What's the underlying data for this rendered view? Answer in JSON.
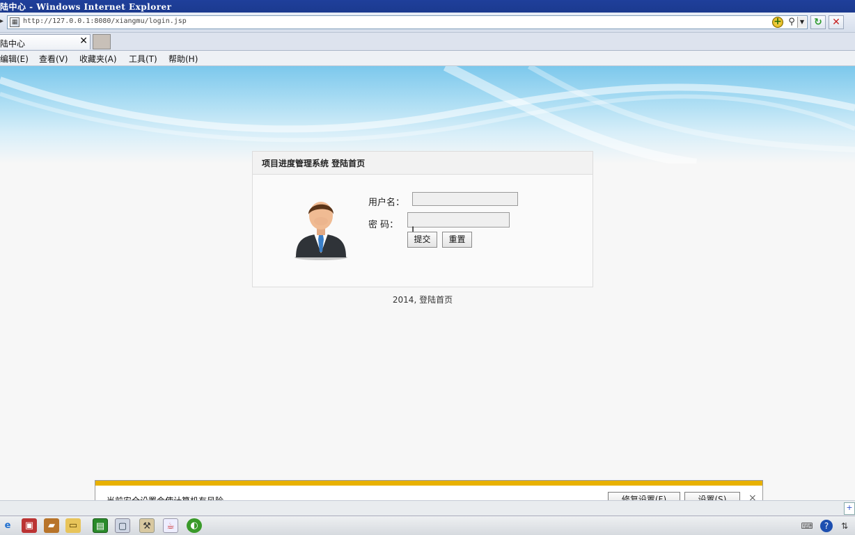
{
  "window": {
    "title": "陆中心 - Windows Internet Explorer"
  },
  "address_bar": {
    "url": "http://127.0.0.1:8080/xiangmu/login.jsp"
  },
  "tab": {
    "label": "陆中心",
    "close_glyph": "✕"
  },
  "menu": [
    {
      "label": "编辑(E)"
    },
    {
      "label": "查看(V)"
    },
    {
      "label": "收藏夹(A)"
    },
    {
      "label": "工具(T)"
    },
    {
      "label": "帮助(H)"
    }
  ],
  "login": {
    "header": "项目进度管理系统 登陆首页",
    "username_label": "用户名：",
    "password_label": "密 码：",
    "username_value": "",
    "password_value": "",
    "submit_label": "提交",
    "reset_label": "重置"
  },
  "footer": {
    "text": "2014, 登陆首页"
  },
  "security_bar": {
    "message": "当前安全设置会使计算机有风险。",
    "fix_label": "修复设置(F)",
    "settings_label": "设置(S)",
    "close_glyph": "×"
  },
  "colors": {
    "title_bar": "#1f3f9b",
    "warning_strip": "#e8b100",
    "banner_blue": "#7cc8ec"
  },
  "taskbar": {
    "icons": [
      "ie-icon",
      "app-icon",
      "book-icon",
      "folder-icon",
      "spreadsheet-icon",
      "monitor-icon",
      "tools-icon",
      "java-icon",
      "green-app-icon"
    ],
    "tray_icons": [
      "keyboard-icon",
      "help-icon",
      "network-icon"
    ]
  }
}
